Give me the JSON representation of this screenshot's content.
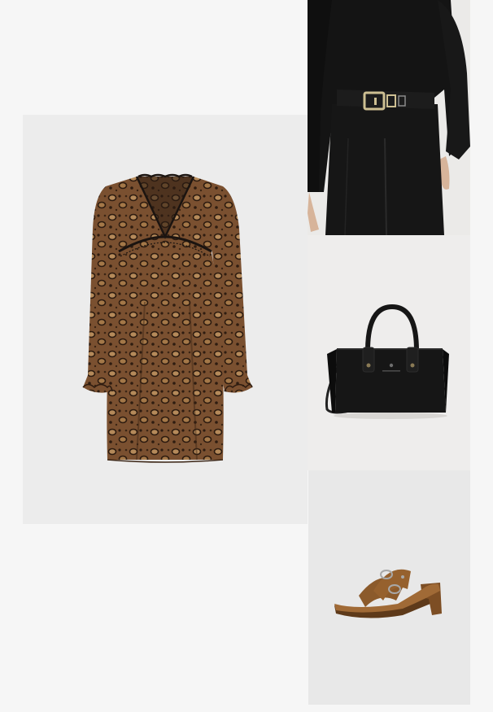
{
  "collage": {
    "items": [
      {
        "item": "leopard-print-dress",
        "colors": {
          "base": "#7a5030",
          "spot": "#2e1c10",
          "light": "#b58a5a",
          "trim": "#1b1410"
        }
      },
      {
        "item": "black-top-with-belt",
        "colors": {
          "top": "#141414",
          "trousers": "#161616",
          "belt": "#1c1c1c",
          "buckle": "#cdbf92",
          "skin": "#d7b49a"
        }
      },
      {
        "item": "black-handbag",
        "colors": {
          "leather": "#161616",
          "studs": "#8a7a55"
        }
      },
      {
        "item": "brown-heeled-sandals",
        "colors": {
          "suede": "#8b5a2b",
          "heel": "#7d4e24",
          "buckle": "#a8a8a8"
        }
      }
    ],
    "background": "#f6f6f6"
  }
}
